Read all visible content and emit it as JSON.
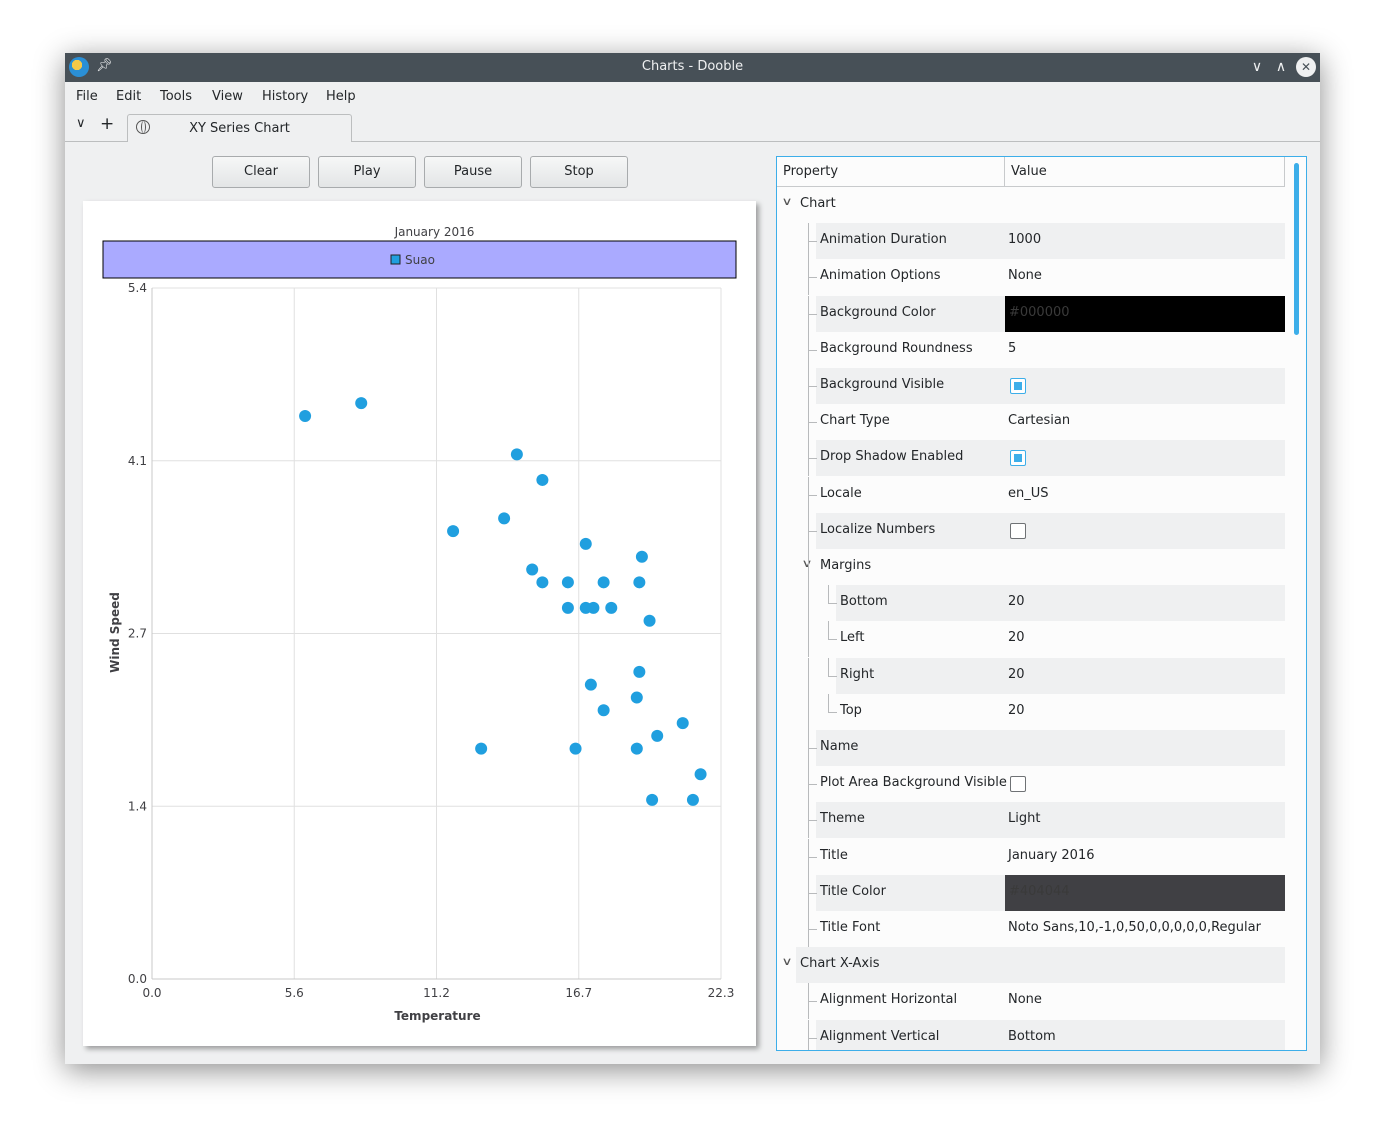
{
  "window": {
    "title": "Charts - Dooble"
  },
  "menu": [
    "File",
    "Edit",
    "Tools",
    "View",
    "History",
    "Help"
  ],
  "tab": {
    "label": "XY Series Chart"
  },
  "toolbar": {
    "clear": "Clear",
    "play": "Play",
    "pause": "Pause",
    "stop": "Stop"
  },
  "tree": {
    "header": {
      "property": "Property",
      "value": "Value"
    },
    "rows": [
      {
        "label": "Chart",
        "value": "",
        "kind": "group"
      },
      {
        "label": "Animation Duration",
        "value": "1000",
        "kind": "text"
      },
      {
        "label": "Animation Options",
        "value": "None",
        "kind": "text"
      },
      {
        "label": "Background Color",
        "value": "#000000",
        "kind": "color",
        "color": "#000000"
      },
      {
        "label": "Background Roundness",
        "value": "5",
        "kind": "text"
      },
      {
        "label": "Background Visible",
        "value": "",
        "kind": "checkbox",
        "checked": true
      },
      {
        "label": "Chart Type",
        "value": "Cartesian",
        "kind": "text"
      },
      {
        "label": "Drop Shadow Enabled",
        "value": "",
        "kind": "checkbox",
        "checked": true
      },
      {
        "label": "Locale",
        "value": "en_US",
        "kind": "text"
      },
      {
        "label": "Localize Numbers",
        "value": "",
        "kind": "checkbox",
        "checked": false
      },
      {
        "label": "Margins",
        "value": "",
        "kind": "subgroup"
      },
      {
        "label": "Bottom",
        "value": "20",
        "kind": "child"
      },
      {
        "label": "Left",
        "value": "20",
        "kind": "child"
      },
      {
        "label": "Right",
        "value": "20",
        "kind": "child"
      },
      {
        "label": "Top",
        "value": "20",
        "kind": "child"
      },
      {
        "label": "Name",
        "value": "",
        "kind": "text"
      },
      {
        "label": "Plot Area Background Visible",
        "value": "",
        "kind": "checkbox",
        "checked": false
      },
      {
        "label": "Theme",
        "value": "Light",
        "kind": "text"
      },
      {
        "label": "Title",
        "value": "January 2016",
        "kind": "text"
      },
      {
        "label": "Title Color",
        "value": "#404044",
        "kind": "color",
        "color": "#404044"
      },
      {
        "label": "Title Font",
        "value": "Noto Sans,10,-1,0,50,0,0,0,0,0,Regular",
        "kind": "text"
      },
      {
        "label": "Chart X-Axis",
        "value": "",
        "kind": "group"
      },
      {
        "label": "Alignment Horizontal",
        "value": "None",
        "kind": "text"
      },
      {
        "label": "Alignment Vertical",
        "value": "Bottom",
        "kind": "text"
      }
    ]
  },
  "chart_data": {
    "type": "scatter",
    "title": "January 2016",
    "xlabel": "Temperature",
    "ylabel": "Wind Speed",
    "xlim": [
      0.0,
      22.3
    ],
    "ylim": [
      0.0,
      5.4
    ],
    "xticks": [
      "0.0",
      "5.6",
      "11.2",
      "16.7",
      "22.3"
    ],
    "yticks": [
      "0.0",
      "1.4",
      "2.7",
      "4.1",
      "5.4"
    ],
    "grid": true,
    "legend_position": "top",
    "legend_background": "#aaaaff",
    "series": [
      {
        "name": "Suao",
        "color": "#209fdf",
        "points": [
          [
            6.0,
            4.4
          ],
          [
            8.2,
            4.5
          ],
          [
            11.8,
            3.5
          ],
          [
            12.9,
            1.8
          ],
          [
            13.8,
            3.6
          ],
          [
            14.3,
            4.1
          ],
          [
            14.9,
            3.2
          ],
          [
            15.3,
            3.9
          ],
          [
            15.3,
            3.1
          ],
          [
            16.3,
            3.1
          ],
          [
            16.3,
            2.9
          ],
          [
            16.6,
            1.8
          ],
          [
            17.0,
            3.4
          ],
          [
            17.0,
            2.9
          ],
          [
            17.3,
            2.9
          ],
          [
            17.2,
            2.3
          ],
          [
            17.7,
            3.1
          ],
          [
            17.7,
            2.1
          ],
          [
            18.0,
            2.9
          ],
          [
            19.0,
            2.2
          ],
          [
            19.0,
            1.8
          ],
          [
            19.1,
            2.4
          ],
          [
            19.1,
            3.1
          ],
          [
            19.2,
            3.3
          ],
          [
            19.5,
            2.8
          ],
          [
            19.6,
            1.4
          ],
          [
            19.8,
            1.9
          ],
          [
            20.8,
            2.0
          ],
          [
            21.2,
            1.4
          ],
          [
            21.5,
            1.6
          ]
        ]
      }
    ]
  }
}
